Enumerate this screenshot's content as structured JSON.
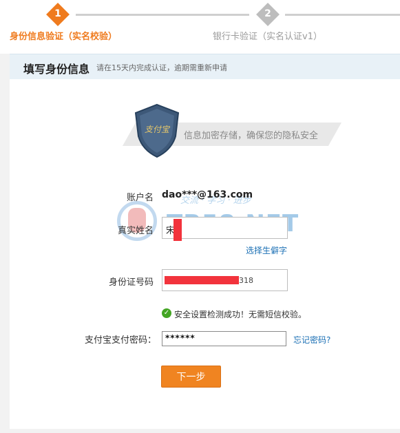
{
  "stepper": {
    "step1": {
      "number": "1",
      "label": "身份信息验证（实名校验）"
    },
    "step2": {
      "number": "2",
      "label": "银行卡验证（实名认证v1）"
    }
  },
  "section": {
    "title": "填写身份信息",
    "subtitle": "请在15天内完成认证，逾期需重新申请"
  },
  "security_banner": {
    "text": "信息加密存储，确保您的隐私安全",
    "shield_text": "支付宝"
  },
  "form": {
    "account_label": "账户名",
    "account_value": "dao***@163.com",
    "realname_label": "真实姓名",
    "realname_value": "宋",
    "rare_char_link": "选择生僻字",
    "id_label": "身份证号码",
    "id_value_tail": "318",
    "security_ok_text": "安全设置检测成功！无需短信校验。",
    "paypwd_label": "支付宝支付密码：",
    "paypwd_value": "******",
    "forgot_link": "忘记密码?",
    "next_button": "下一步"
  },
  "watermark": {
    "big_text": "TB58.NET",
    "small_text": "交流 · 学习 · 进步"
  },
  "colors": {
    "accent": "#ef7b1e",
    "inactive": "#bdbdbd",
    "link": "#1a6fb4",
    "success": "#44a524",
    "redaction": "#f2333c"
  }
}
